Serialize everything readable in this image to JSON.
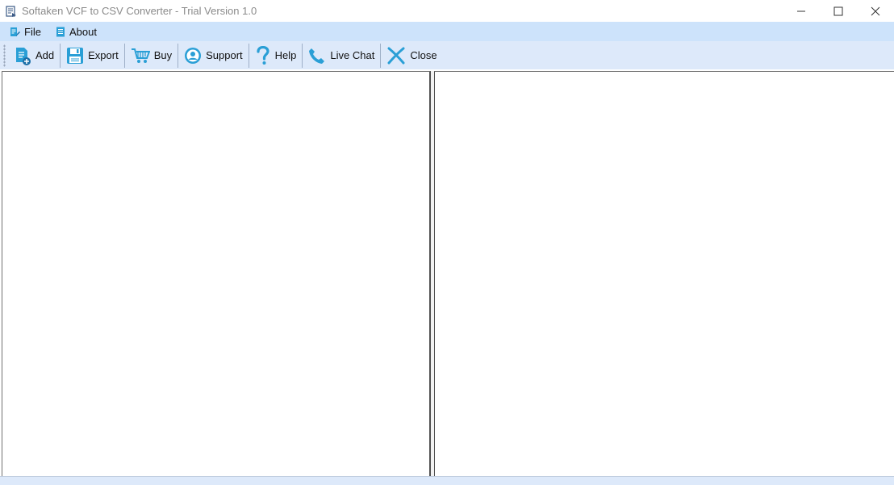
{
  "window": {
    "title": "Softaken VCF to CSV Converter - Trial Version 1.0"
  },
  "menu": {
    "items": [
      {
        "label": "File",
        "icon": "file-edit-icon"
      },
      {
        "label": "About",
        "icon": "document-icon"
      }
    ]
  },
  "toolbar": {
    "buttons": [
      {
        "label": "Add",
        "icon": "add-file-icon"
      },
      {
        "label": "Export",
        "icon": "save-disk-icon"
      },
      {
        "label": "Buy",
        "icon": "cart-icon"
      },
      {
        "label": "Support",
        "icon": "user-circle-icon"
      },
      {
        "label": "Help",
        "icon": "question-icon"
      },
      {
        "label": "Live Chat",
        "icon": "phone-icon"
      },
      {
        "label": "Close",
        "icon": "close-x-icon"
      }
    ]
  },
  "colors": {
    "accent": "#2a9fd6",
    "menubar_bg": "#cde3fb",
    "toolbar_bg": "#dde9fa"
  }
}
